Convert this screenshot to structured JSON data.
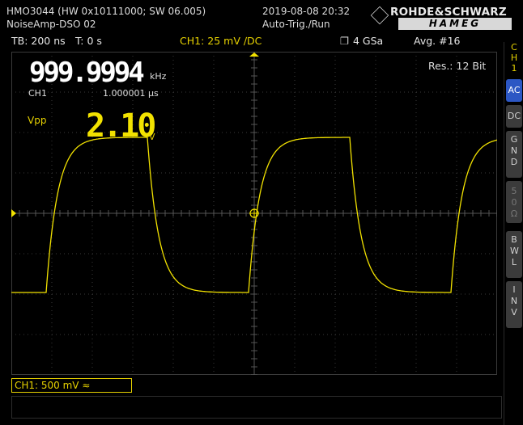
{
  "header": {
    "device": "HMO3044 (HW 0x10111000; SW 06.005)",
    "datetime": "2019-08-08 20:32",
    "setup_name": "NoiseAmp-DSO 02",
    "trigger_mode": "Auto-Trig./Run",
    "brand_top": "ROHDE&SCHWARZ",
    "brand_bottom": "HAMEG"
  },
  "status": {
    "timebase": "TB: 200 ns",
    "trigger_time": "T: 0 s",
    "channel": "CH1: 25 mV ∕DC",
    "sample_rate": "4 GSa",
    "averaging": "Avg. #16"
  },
  "measurements": {
    "frequency": "999.9994",
    "frequency_unit": "kHz",
    "channel_label": "CH1",
    "period": "1.000001 µs",
    "resolution": "Res.: 12 Bit",
    "vpp_label": "Vpp",
    "vpp_value": "2.10",
    "vpp_unit": "V"
  },
  "side_panel": {
    "channel_tag": [
      "C",
      "H",
      "1"
    ],
    "buttons": [
      {
        "label": "AC",
        "active": true
      },
      {
        "label": "DC",
        "active": false
      },
      {
        "label": "GND",
        "active": false
      },
      {
        "label": "50Ω",
        "active": false,
        "dim": true
      },
      {
        "label": "BWL",
        "active": false
      },
      {
        "label": "INV",
        "active": false
      }
    ]
  },
  "bottom": {
    "channel_setting": "CH1: 500 mV ≈"
  },
  "colors": {
    "trace": "#f2e200",
    "grid": "#3a3a3a",
    "accent_blue": "#2c57c4"
  }
}
